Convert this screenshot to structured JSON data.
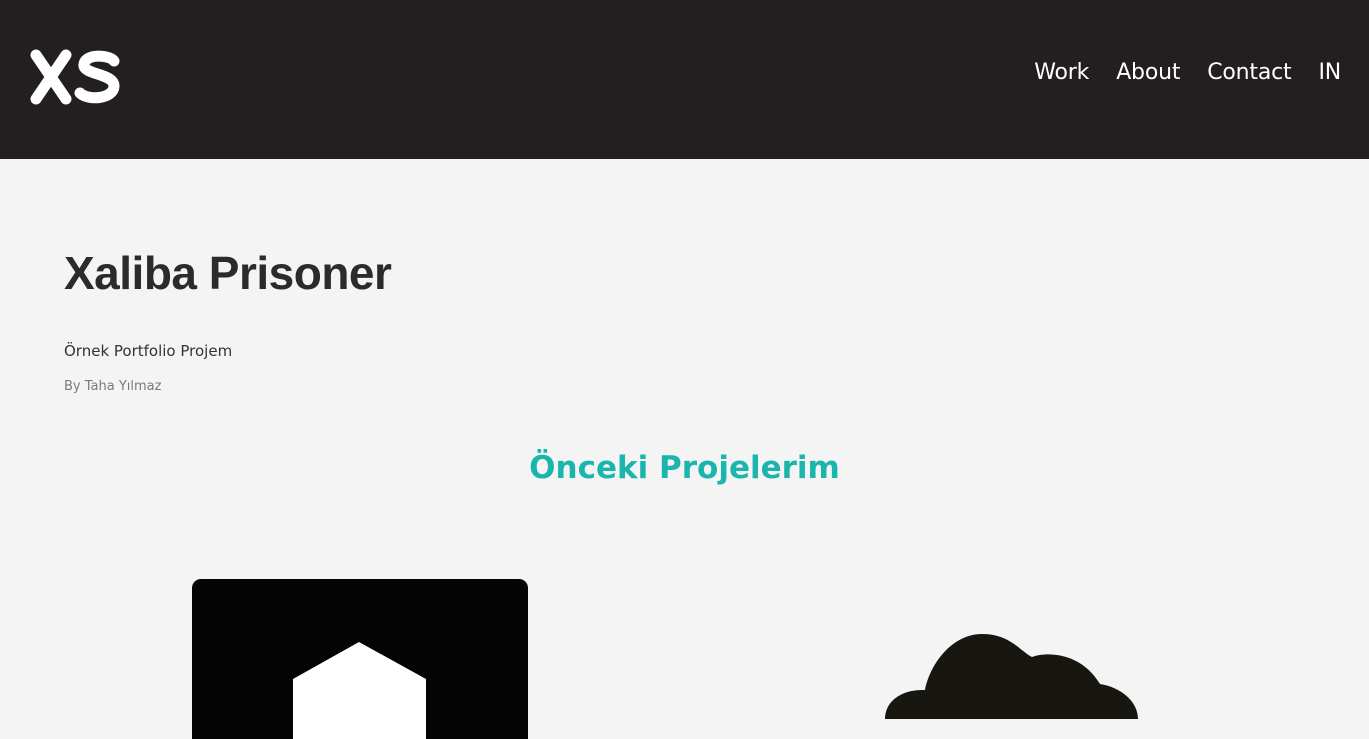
{
  "header": {
    "logo_text": "XS",
    "nav": [
      {
        "label": "Work"
      },
      {
        "label": "About"
      },
      {
        "label": "Contact"
      },
      {
        "label": "IN"
      }
    ]
  },
  "project": {
    "title": "Xaliba Prisoner",
    "subtitle": "Örnek Portfolio Projem",
    "author": "By Taha Yılmaz"
  },
  "previous": {
    "heading": "Önceki Projelerim"
  },
  "colors": {
    "header_bg": "#231f20",
    "page_bg": "#f4f4f4",
    "accent": "#1ab5ac"
  }
}
